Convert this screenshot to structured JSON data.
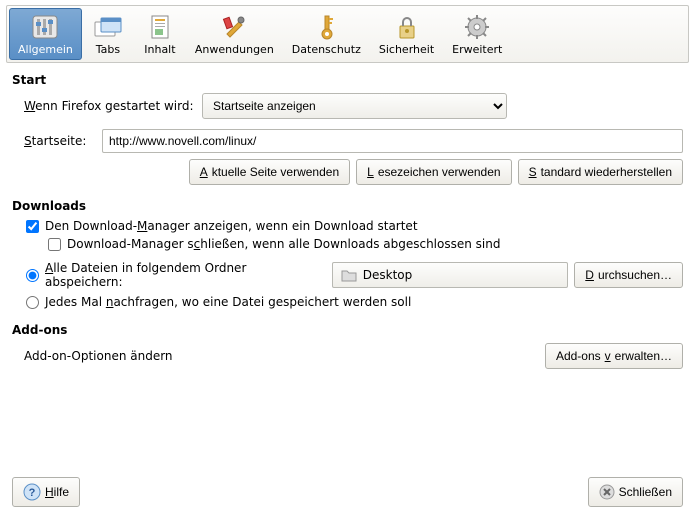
{
  "toolbar": {
    "items": [
      {
        "label": "Allgemein"
      },
      {
        "label": "Tabs"
      },
      {
        "label": "Inhalt"
      },
      {
        "label": "Anwendungen"
      },
      {
        "label": "Datenschutz"
      },
      {
        "label": "Sicherheit"
      },
      {
        "label": "Erweitert"
      }
    ]
  },
  "start": {
    "title": "Start",
    "when_label_pre": "W",
    "when_label_post": "enn Firefox gestartet wird:",
    "when_value": "Startseite anzeigen",
    "homepage_label_pre": "S",
    "homepage_label_post": "tartseite:",
    "homepage_value": "http://www.novell.com/linux/",
    "btn_current_pre": "A",
    "btn_current_post": "ktuelle Seite verwenden",
    "btn_bookmark_pre": "L",
    "btn_bookmark_post": "esezeichen verwenden",
    "btn_default_pre": "S",
    "btn_default_post": "tandard wiederherstellen"
  },
  "downloads": {
    "title": "Downloads",
    "show_mgr_pre1": "Den Download-",
    "show_mgr_u": "M",
    "show_mgr_post": "anager anzeigen, wenn ein Download startet",
    "close_mgr_pre": "Download-Manager s",
    "close_mgr_u": "c",
    "close_mgr_post": "hließen, wenn alle Downloads abgeschlossen sind",
    "save_to_pre": "A",
    "save_to_post": "lle Dateien in folgendem Ordner abspeichern:",
    "folder": "Desktop",
    "browse_pre": "D",
    "browse_post": "urchsuchen…",
    "ask_pre": "Jedes Mal ",
    "ask_u": "n",
    "ask_post": "achfragen, wo eine Datei gespeichert werden soll"
  },
  "addons": {
    "title": "Add-ons",
    "desc": "Add-on-Optionen ändern",
    "manage_pre": "Add-ons ",
    "manage_u": "v",
    "manage_post": "erwalten…"
  },
  "footer": {
    "help_pre": "H",
    "help_post": "ilfe",
    "close": "Schließen"
  }
}
